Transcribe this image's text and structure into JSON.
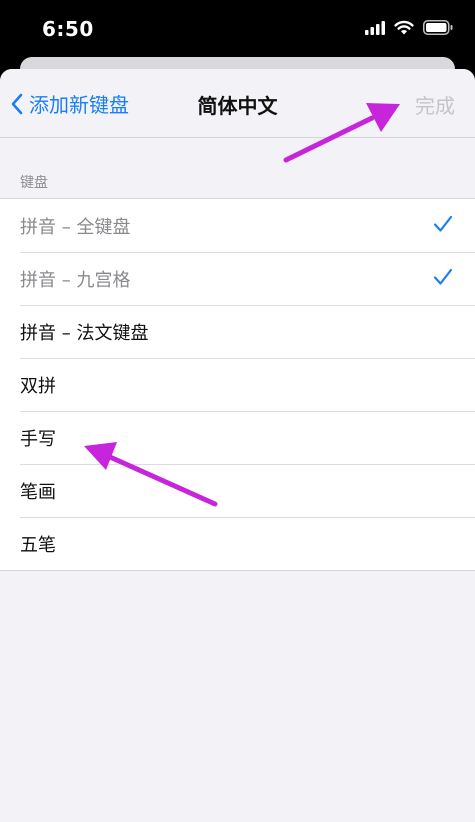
{
  "status_bar": {
    "time": "6:50"
  },
  "nav": {
    "back_label": "添加新键盘",
    "title": "简体中文",
    "done_label": "完成"
  },
  "section": {
    "header": "键盘"
  },
  "keyboards": [
    {
      "label": "拼音 – 全键盘",
      "checked": true
    },
    {
      "label": "拼音 – 九宫格",
      "checked": true
    },
    {
      "label": "拼音 – 法文键盘",
      "checked": false
    },
    {
      "label": "双拼",
      "checked": false
    },
    {
      "label": "手写",
      "checked": false
    },
    {
      "label": "笔画",
      "checked": false
    },
    {
      "label": "五笔",
      "checked": false
    }
  ],
  "colors": {
    "accent": "#1a7ff5",
    "annotation_arrow": "#c625dc"
  }
}
